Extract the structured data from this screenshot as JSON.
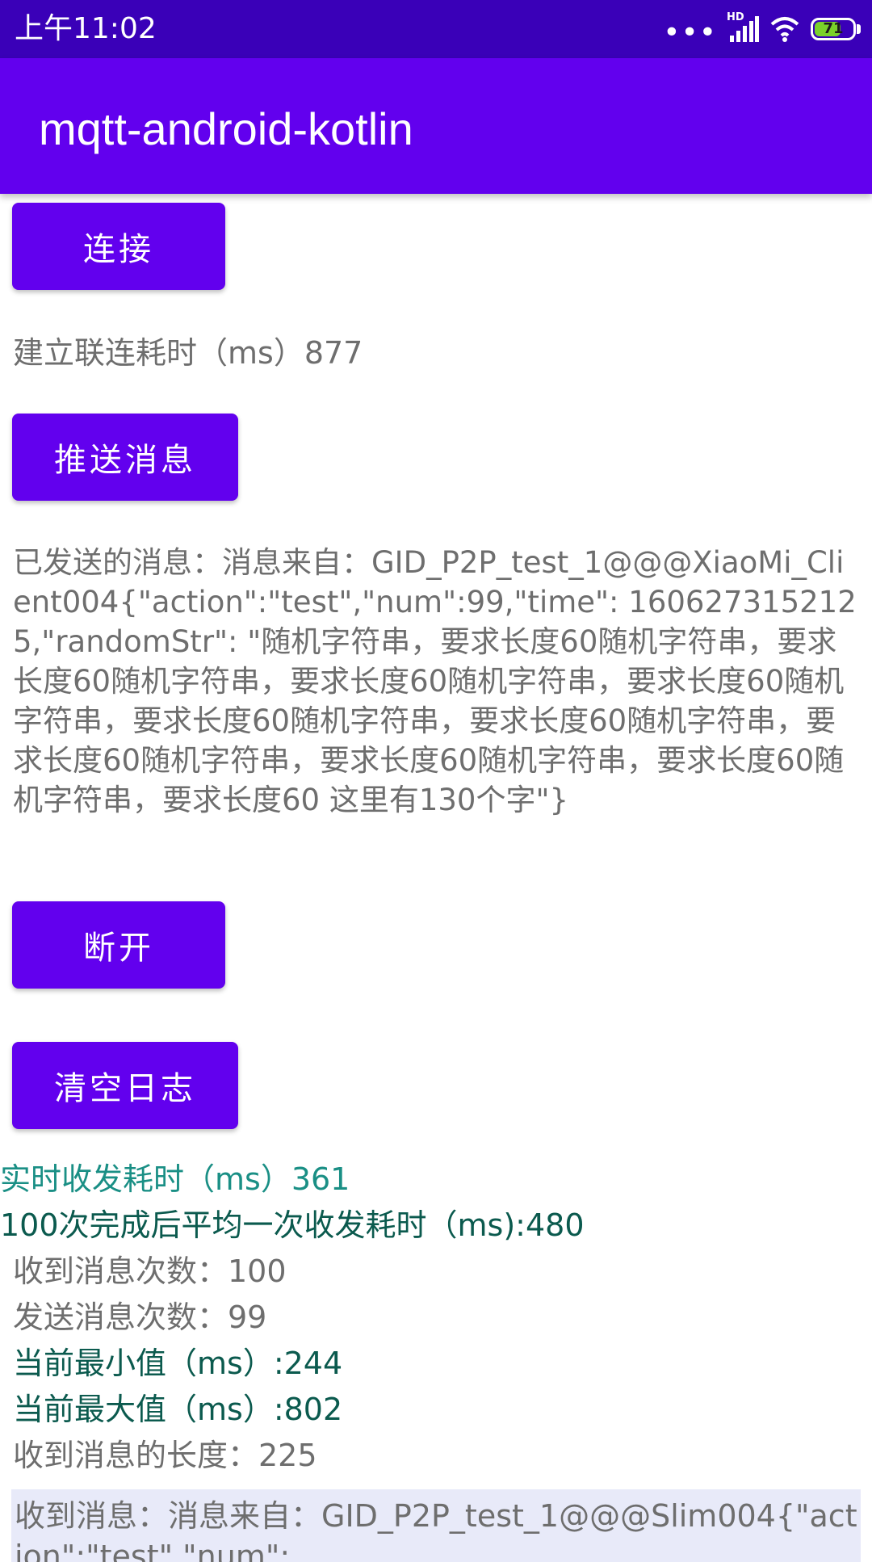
{
  "status_bar": {
    "time": "上午11:02",
    "network": "HD",
    "battery": "71",
    "battery_level": 0.71
  },
  "app_bar": {
    "title": "mqtt-android-kotlin"
  },
  "buttons": {
    "connect": "连接",
    "publish": "推送消息",
    "disconnect": "断开",
    "clear_log": "清空日志"
  },
  "connect_time_text": "建立联连耗时（ms）877",
  "sent_message": "已发送的消息：消息来自：GID_P2P_test_1@@@XiaoMi_Client004{\"action\":\"test\",\"num\":99,\"time\": 1606273152125,\"randomStr\":  \"随机字符串，要求长度60随机字符串，要求长度60随机字符串，要求长度60随机字符串，要求长度60随机字符串，要求长度60随机字符串，要求长度60随机字符串，要求长度60随机字符串，要求长度60随机字符串，要求长度60随机字符串，要求长度60 这里有130个字\"}",
  "stats": {
    "realtime": "实时收发耗时（ms）361",
    "average": "100次完成后平均一次收发耗时（ms):480",
    "received_count": "收到消息次数：100",
    "sent_count": "发送消息次数：99",
    "min": "当前最小值（ms）:244",
    "max": "当前最大值（ms）:802",
    "received_length": "收到消息的长度：225"
  },
  "received_message": "收到消息：消息来自：GID_P2P_test_1@@@Slim004{\"action\":\"test\",\"num\":",
  "colors": {
    "status_bar": "#3a00b8",
    "app_bar": "#6200ee",
    "button": "#6200ee",
    "teal_text": "#1a8f85",
    "dark_green_text": "#0b5a4e",
    "grey_text": "#6e6e6e",
    "received_box": "#e8eaf9"
  },
  "icons": [
    "signal-icon",
    "wifi-icon",
    "battery-icon"
  ]
}
